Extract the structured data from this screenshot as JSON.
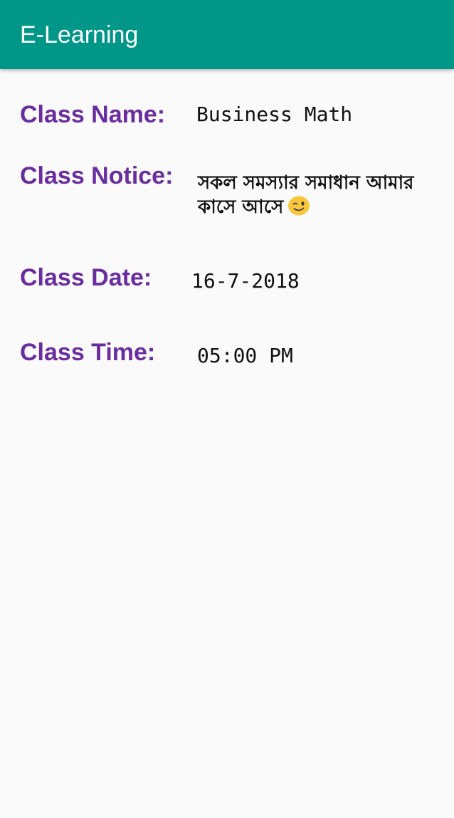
{
  "app_bar": {
    "title": "E-Learning"
  },
  "class_details": {
    "name_label": "Class Name:",
    "name_value": "Business Math",
    "notice_label": "Class Notice:",
    "notice_value": "সকল সমস্যার সমাধান আমার কাসে আসে",
    "notice_emoji_icon": "winking-face-icon",
    "date_label": "Class Date:",
    "date_value": "16-7-2018",
    "time_label": "Class Time:",
    "time_value": "05:00 PM"
  },
  "colors": {
    "app_bar": "#009688",
    "label": "#6a2c9e",
    "background": "#fafafa",
    "value_text": "#111111"
  }
}
